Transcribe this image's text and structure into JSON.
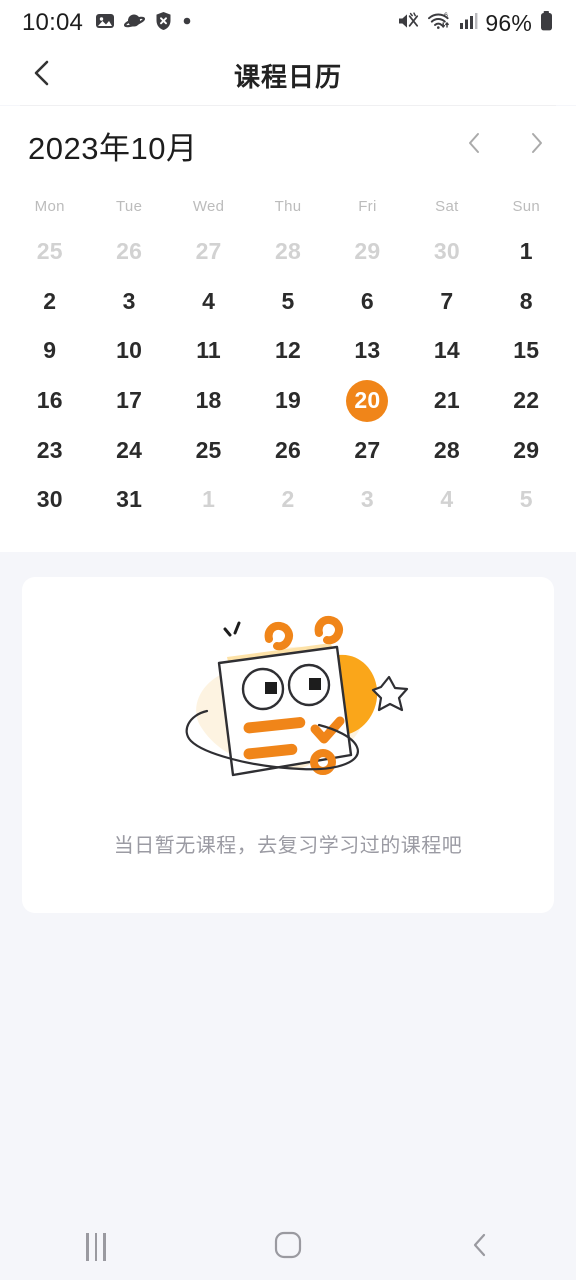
{
  "statusbar": {
    "time": "10:04",
    "battery_percent": "96%",
    "left_icons": [
      "image-icon",
      "planet-icon",
      "shield-x-icon",
      "dot-icon"
    ],
    "right_icons": [
      "mute-vibrate-icon",
      "wifi-6-icon",
      "cellular-signal-icon",
      "battery-icon"
    ]
  },
  "header": {
    "title": "课程日历",
    "back_icon": "chevron-left-icon"
  },
  "calendar": {
    "month_label": "2023年10月",
    "prev_icon": "chevron-left-icon",
    "next_icon": "chevron-right-icon",
    "weekdays": [
      "Mon",
      "Tue",
      "Wed",
      "Thu",
      "Fri",
      "Sat",
      "Sun"
    ],
    "selected_day": "20",
    "accent_color": "#f08519",
    "days": [
      {
        "label": "25",
        "muted": true,
        "selected": false
      },
      {
        "label": "26",
        "muted": true,
        "selected": false
      },
      {
        "label": "27",
        "muted": true,
        "selected": false
      },
      {
        "label": "28",
        "muted": true,
        "selected": false
      },
      {
        "label": "29",
        "muted": true,
        "selected": false
      },
      {
        "label": "30",
        "muted": true,
        "selected": false
      },
      {
        "label": "1",
        "muted": false,
        "selected": false
      },
      {
        "label": "2",
        "muted": false,
        "selected": false
      },
      {
        "label": "3",
        "muted": false,
        "selected": false
      },
      {
        "label": "4",
        "muted": false,
        "selected": false
      },
      {
        "label": "5",
        "muted": false,
        "selected": false
      },
      {
        "label": "6",
        "muted": false,
        "selected": false
      },
      {
        "label": "7",
        "muted": false,
        "selected": false
      },
      {
        "label": "8",
        "muted": false,
        "selected": false
      },
      {
        "label": "9",
        "muted": false,
        "selected": false
      },
      {
        "label": "10",
        "muted": false,
        "selected": false
      },
      {
        "label": "11",
        "muted": false,
        "selected": false
      },
      {
        "label": "12",
        "muted": false,
        "selected": false
      },
      {
        "label": "13",
        "muted": false,
        "selected": false
      },
      {
        "label": "14",
        "muted": false,
        "selected": false
      },
      {
        "label": "15",
        "muted": false,
        "selected": false
      },
      {
        "label": "16",
        "muted": false,
        "selected": false
      },
      {
        "label": "17",
        "muted": false,
        "selected": false
      },
      {
        "label": "18",
        "muted": false,
        "selected": false
      },
      {
        "label": "19",
        "muted": false,
        "selected": false
      },
      {
        "label": "20",
        "muted": false,
        "selected": true
      },
      {
        "label": "21",
        "muted": false,
        "selected": false
      },
      {
        "label": "22",
        "muted": false,
        "selected": false
      },
      {
        "label": "23",
        "muted": false,
        "selected": false
      },
      {
        "label": "24",
        "muted": false,
        "selected": false
      },
      {
        "label": "25",
        "muted": false,
        "selected": false
      },
      {
        "label": "26",
        "muted": false,
        "selected": false
      },
      {
        "label": "27",
        "muted": false,
        "selected": false
      },
      {
        "label": "28",
        "muted": false,
        "selected": false
      },
      {
        "label": "29",
        "muted": false,
        "selected": false
      },
      {
        "label": "30",
        "muted": false,
        "selected": false
      },
      {
        "label": "31",
        "muted": false,
        "selected": false
      },
      {
        "label": "1",
        "muted": true,
        "selected": false
      },
      {
        "label": "2",
        "muted": true,
        "selected": false
      },
      {
        "label": "3",
        "muted": true,
        "selected": false
      },
      {
        "label": "4",
        "muted": true,
        "selected": false
      },
      {
        "label": "5",
        "muted": true,
        "selected": false
      }
    ]
  },
  "empty_state": {
    "message": "当日暂无课程，去复习学习过的课程吧",
    "illustration": "calendar-character-illustration"
  },
  "navbar": {
    "recents_icon": "recents-icon",
    "home_icon": "home-icon",
    "back_icon": "back-icon"
  }
}
